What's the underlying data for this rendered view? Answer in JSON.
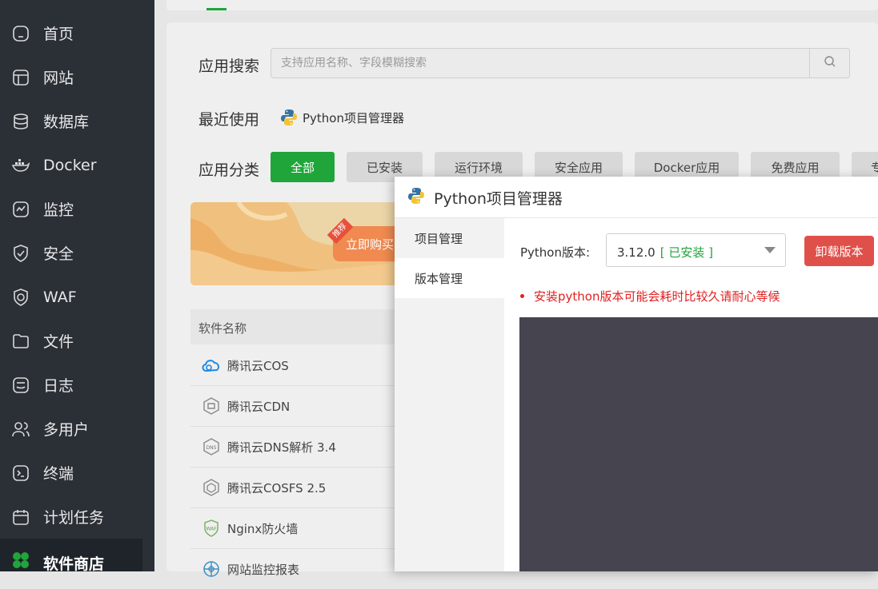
{
  "sidebar": {
    "items": [
      {
        "label": "首页",
        "icon": "home-icon"
      },
      {
        "label": "网站",
        "icon": "website-icon"
      },
      {
        "label": "数据库",
        "icon": "database-icon"
      },
      {
        "label": "Docker",
        "icon": "docker-icon"
      },
      {
        "label": "监控",
        "icon": "monitor-icon"
      },
      {
        "label": "安全",
        "icon": "shield-icon"
      },
      {
        "label": "WAF",
        "icon": "waf-icon"
      },
      {
        "label": "文件",
        "icon": "folder-icon"
      },
      {
        "label": "日志",
        "icon": "log-icon"
      },
      {
        "label": "多用户",
        "icon": "users-icon"
      },
      {
        "label": "终端",
        "icon": "terminal-icon"
      },
      {
        "label": "计划任务",
        "icon": "calendar-icon"
      },
      {
        "label": "软件商店",
        "icon": "store-icon",
        "active": true
      }
    ]
  },
  "search": {
    "label": "应用搜索",
    "placeholder": "支持应用名称、字段模糊搜索"
  },
  "recent": {
    "label": "最近使用",
    "items": [
      "Python项目管理器"
    ]
  },
  "category": {
    "label": "应用分类",
    "items": [
      "全部",
      "已安装",
      "运行环境",
      "安全应用",
      "Docker应用",
      "免费应用",
      "专"
    ],
    "active": "全部"
  },
  "banner": {
    "tag": "推荐",
    "button": "立即购买"
  },
  "table": {
    "header": "软件名称",
    "rows": [
      {
        "name": "腾讯云COS",
        "icon": "cloud-icon"
      },
      {
        "name": "腾讯云CDN",
        "icon": "cdn-icon"
      },
      {
        "name": "腾讯云DNS解析 3.4",
        "icon": "dns-icon"
      },
      {
        "name": "腾讯云COSFS 2.5",
        "icon": "cosfs-icon"
      },
      {
        "name": "Nginx防火墙",
        "icon": "waf-badge-icon"
      },
      {
        "name": "网站监控报表",
        "icon": "globe-icon"
      }
    ]
  },
  "dialog": {
    "title": "Python项目管理器",
    "tabs": [
      "项目管理",
      "版本管理"
    ],
    "active_tab": "版本管理",
    "version_label": "Python版本:",
    "version_value": "3.12.0",
    "version_status": "[ 已安装 ]",
    "uninstall_label": "卸载版本",
    "warning": "安装python版本可能会耗时比较久请耐心等候"
  },
  "colors": {
    "accent": "#20a53a",
    "sidebar_bg": "#2b2f36",
    "danger": "#e0504a",
    "console_bg": "#45444f"
  }
}
